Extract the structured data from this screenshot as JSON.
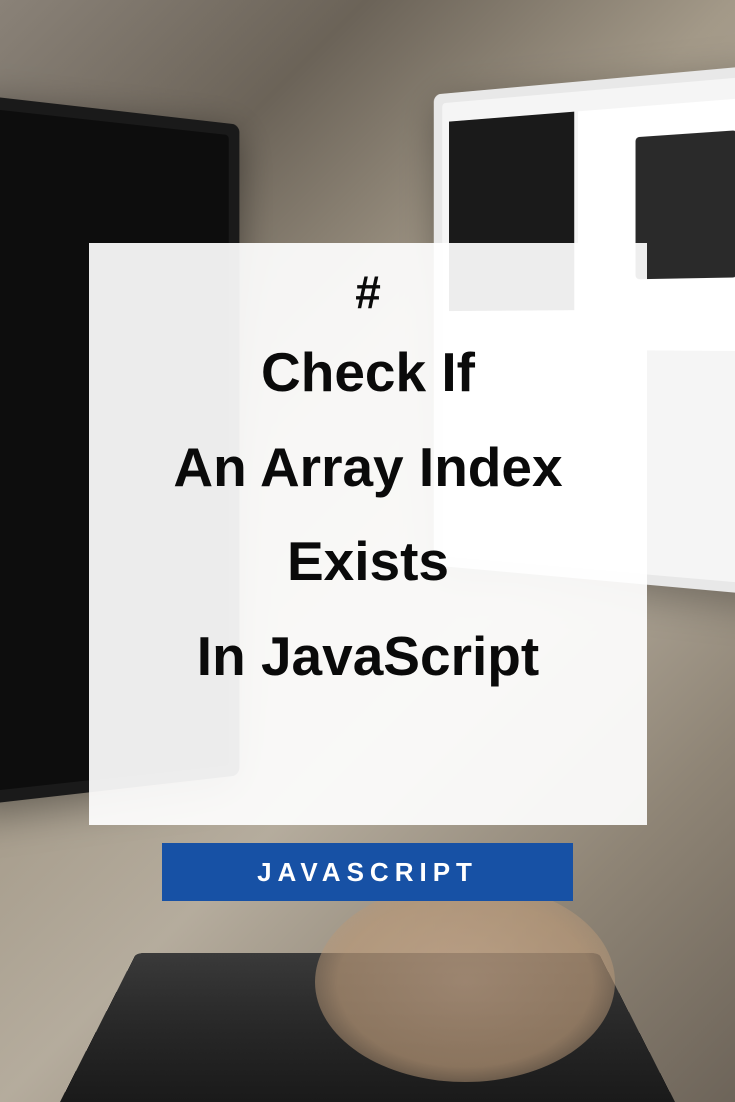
{
  "card": {
    "hash": "#",
    "line1": "Check If",
    "line2": "An Array Index",
    "line3": "Exists",
    "line4": "In JavaScript"
  },
  "tag": {
    "label": "JAVASCRIPT"
  }
}
